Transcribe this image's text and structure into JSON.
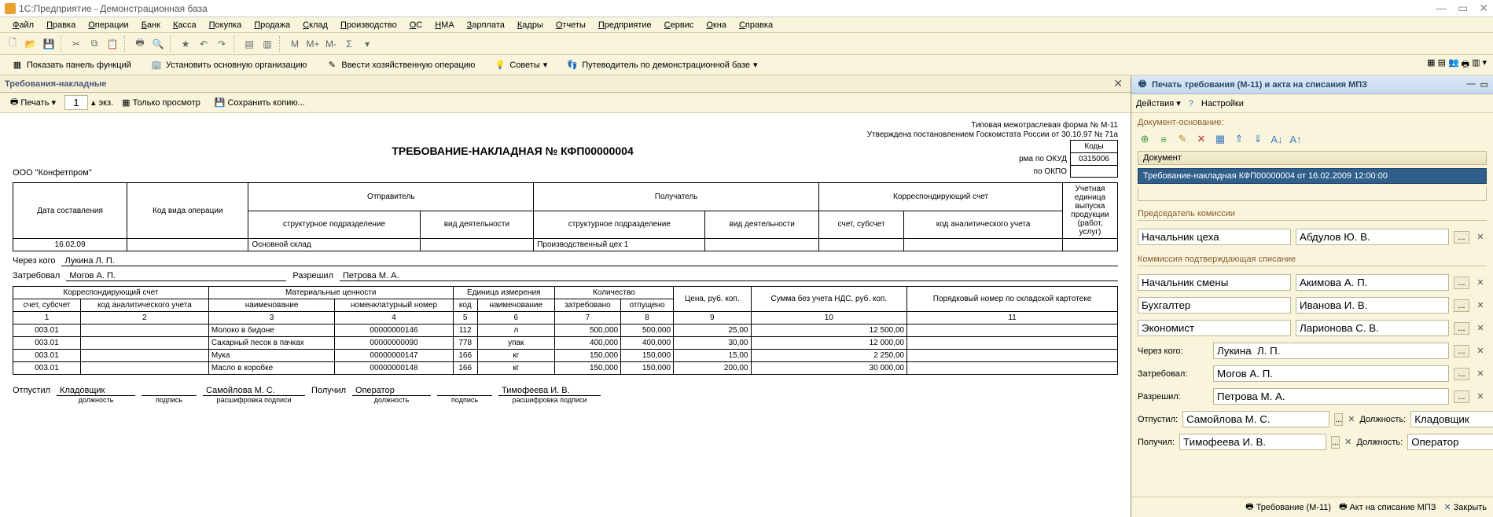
{
  "window": {
    "title": "1С:Предприятие - Демонстрационная база"
  },
  "menu": [
    "Файл",
    "Правка",
    "Операции",
    "Банк",
    "Касса",
    "Покупка",
    "Продажа",
    "Склад",
    "Производство",
    "ОС",
    "НМА",
    "Зарплата",
    "Кадры",
    "Отчеты",
    "Предприятие",
    "Сервис",
    "Окна",
    "Справка"
  ],
  "sec_buttons": {
    "show_panel": "Показать панель функций",
    "set_org": "Установить основную организацию",
    "enter_op": "Ввести хозяйственную операцию",
    "tips": "Советы",
    "guide": "Путеводитель по демонстрационной базе"
  },
  "tab": {
    "title": "Требования-накладные"
  },
  "doc_toolbar": {
    "print": "Печать",
    "copies": "1",
    "copies_suffix": "экз.",
    "preview": "Только просмотр",
    "save": "Сохранить копию..."
  },
  "doc": {
    "form_line1": "Типовая межотраслевая форма № М-11",
    "form_line2": "Утверждена постановлением Госкомстата России от 30.10.97 № 71а",
    "title": "ТРЕБОВАНИЕ-НАКЛАДНАЯ № КФП00000004",
    "codes_hdr": "Коды",
    "okud_lbl": "рма по ОКУД",
    "okud": "0315006",
    "okpo_lbl": "по ОКПО",
    "okpo": "",
    "org": "ООО \"Конфетпром\"",
    "big_headers": {
      "date": "Дата составления",
      "op_code": "Код вида операции",
      "sender": "Отправитель",
      "struct": "структурное подразделение",
      "activity": "вид деятельности",
      "receiver": "Получатель",
      "corr_acct": "Корреспондирующий счет",
      "acct": "счет, субсчет",
      "analyt": "код аналитического учета",
      "unit": "Учетная единица выпуска продукции (работ, услуг)"
    },
    "big_values": {
      "date": "16.02.09",
      "op_code": "",
      "sender_struct": "Основной склад",
      "sender_act": "",
      "recv_struct": "Производственный цех 1",
      "recv_act": "",
      "acct": "",
      "analyt": "",
      "unit": ""
    },
    "via_lbl": "Через кого",
    "via": "Лукина Л. П.",
    "demanded_lbl": "Затребовал",
    "demanded": "Могов А. П.",
    "allowed_lbl": "Разрешил",
    "allowed": "Петрова М. А.",
    "items_hdr": {
      "corr": "Корреспондирующий счет",
      "acct": "счет, субсчет",
      "analyt": "код аналитического учета",
      "mat": "Материальные ценности",
      "name": "наименование",
      "nomen": "номенклатурный номер",
      "unit": "Единица измерения",
      "code": "код",
      "unit_name": "наименование",
      "qty": "Количество",
      "demanded": "затребовано",
      "released": "отпущено",
      "price": "Цена, руб. коп.",
      "sum": "Сумма без учета НДС, руб. коп.",
      "card": "Порядковый номер по складской картотеке"
    },
    "col_nums": [
      "1",
      "2",
      "3",
      "4",
      "5",
      "6",
      "7",
      "8",
      "9",
      "10",
      "11"
    ],
    "rows": [
      {
        "acct": "003.01",
        "analyt": "",
        "name": "Молоко в бидоне",
        "nomen": "00000000146",
        "code": "112",
        "unit": "л",
        "dem": "500,000",
        "rel": "500,000",
        "price": "25,00",
        "sum": "12 500,00",
        "card": ""
      },
      {
        "acct": "003.01",
        "analyt": "",
        "name": "Сахарный песок в пачках",
        "nomen": "00000000090",
        "code": "778",
        "unit": "упак",
        "dem": "400,000",
        "rel": "400,000",
        "price": "30,00",
        "sum": "12 000,00",
        "card": ""
      },
      {
        "acct": "003.01",
        "analyt": "",
        "name": "Мука",
        "nomen": "00000000147",
        "code": "166",
        "unit": "кг",
        "dem": "150,000",
        "rel": "150,000",
        "price": "15,00",
        "sum": "2 250,00",
        "card": ""
      },
      {
        "acct": "003.01",
        "analyt": "",
        "name": "Масло в коробке",
        "nomen": "00000000148",
        "code": "166",
        "unit": "кг",
        "dem": "150,000",
        "rel": "150,000",
        "price": "200,00",
        "sum": "30 000,00",
        "card": ""
      }
    ],
    "foot": {
      "released_lbl": "Отпустил",
      "released_pos": "Кладовщик",
      "released_name": "Самойлова М. С.",
      "received_lbl": "Получил",
      "received_pos": "Оператор",
      "received_name": "Тимофеева И. В.",
      "sub_pos": "должность",
      "sub_sign": "подпись",
      "sub_name": "расшифровка подписи"
    }
  },
  "right": {
    "title": "Печать требования (М-11) и акта на списания МПЗ",
    "actions": "Действия",
    "settings": "Настройки",
    "basis_lbl": "Документ-основание:",
    "grid_col": "Документ",
    "grid_val": "Требование-накладная КФП00000004 от 16.02.2009 12:00:00",
    "chair_section": "Председатель комиссии",
    "commission_section": "Коммиссия подтверждающая списание",
    "rows": {
      "chair_pos": "Начальник цеха",
      "chair_name": "Абдулов Ю. В.",
      "r1_pos": "Начальник смены",
      "r1_name": "Акимова А. П.",
      "r2_pos": "Бухгалтер",
      "r2_name": "Иванова И. В.",
      "r3_pos": "Экономист",
      "r3_name": "Ларионова С. В."
    },
    "via_lbl": "Через кого:",
    "via": "Лукина  Л. П.",
    "dem_lbl": "Затребовал:",
    "dem": "Могов А. П.",
    "allow_lbl": "Разрешил:",
    "allow": "Петрова М. А.",
    "rel_lbl": "Отпустил:",
    "rel": "Самойлова М. С.",
    "rec_lbl": "Получил:",
    "rec": "Тимофеева И. В.",
    "pos_lbl": "Должность:",
    "rel_pos": "Кладовщик",
    "rec_pos": "Оператор",
    "footer": {
      "req": "Требование (М-11)",
      "act": "Акт на списание МПЗ",
      "close": "Закрыть"
    }
  }
}
